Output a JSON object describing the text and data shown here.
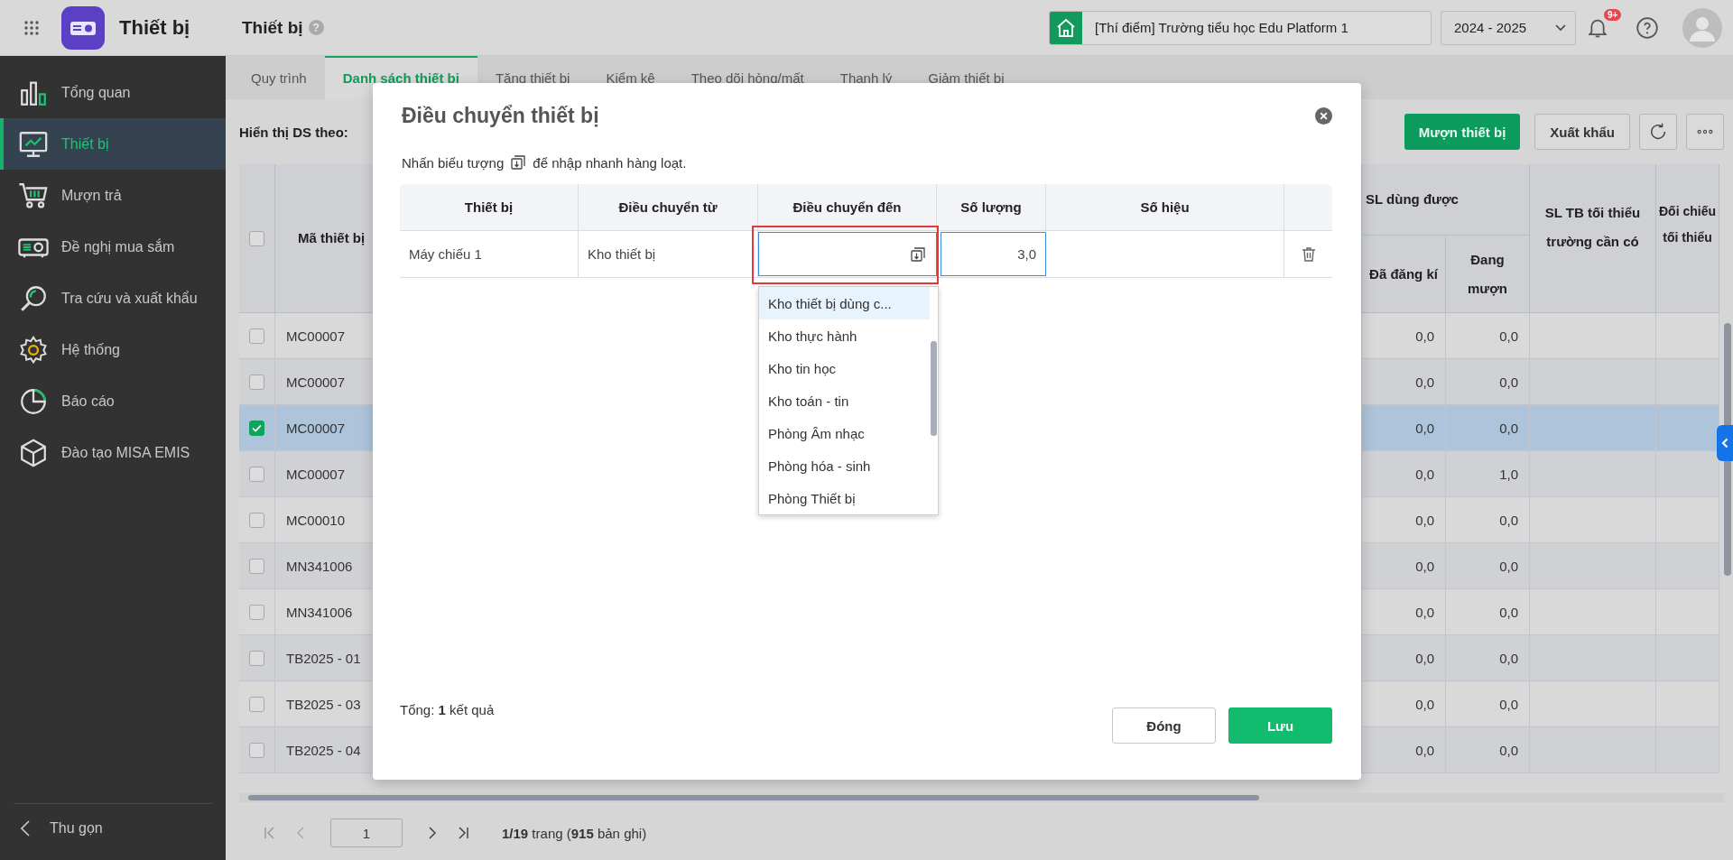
{
  "app": {
    "title": "Thiết bị"
  },
  "header": {
    "page_title": "Thiết bị",
    "help": "?",
    "school": "[Thí điểm] Trường tiểu học Edu Platform 1",
    "school_year": "2024 - 2025",
    "notification_badge": "9+"
  },
  "sidebar": {
    "items": [
      {
        "label": "Tổng quan",
        "selected": false
      },
      {
        "label": "Thiết bị",
        "selected": true
      },
      {
        "label": "Mượn trả",
        "selected": false
      },
      {
        "label": "Đề nghị mua sắm",
        "selected": false
      },
      {
        "label": "Tra cứu và xuất khẩu",
        "selected": false
      },
      {
        "label": "Hệ thống",
        "selected": false
      },
      {
        "label": "Báo cáo",
        "selected": false
      },
      {
        "label": "Đào tạo MISA EMIS",
        "selected": false
      }
    ],
    "collapse": "Thu gọn"
  },
  "tabs": [
    {
      "label": "Quy trình",
      "selected": false
    },
    {
      "label": "Danh sách thiết bị",
      "selected": true
    },
    {
      "label": "Tăng thiết bị",
      "selected": false
    },
    {
      "label": "Kiểm kê",
      "selected": false
    },
    {
      "label": "Theo dõi hỏng/mất",
      "selected": false
    },
    {
      "label": "Thanh lý",
      "selected": false
    },
    {
      "label": "Giảm thiết bị",
      "selected": false
    }
  ],
  "toolbar": {
    "filter_label": "Hiển thị DS theo:",
    "buttons": [
      {
        "label": "Mượn thiết bị",
        "kind": "primary"
      },
      {
        "label": "Xuất khẩu",
        "kind": "secondary"
      }
    ]
  },
  "table": {
    "select_all_checked": false,
    "code_column": "Mã thiết bị",
    "group_column": "SL dùng được",
    "columns": [
      "Đã đăng kí",
      "Đang mượn",
      "SL TB tối thiểu trường cần có",
      "Đối chiếu tối thiểu"
    ],
    "rows": [
      {
        "checked": false,
        "code": "MC00007",
        "registered": "0,0",
        "borrowed": "0,0"
      },
      {
        "checked": false,
        "code": "MC00007",
        "registered": "0,0",
        "borrowed": "0,0"
      },
      {
        "checked": true,
        "code": "MC00007",
        "registered": "0,0",
        "borrowed": "0,0"
      },
      {
        "checked": false,
        "code": "MC00007",
        "registered": "0,0",
        "borrowed": "1,0"
      },
      {
        "checked": false,
        "code": "MC00010",
        "registered": "0,0",
        "borrowed": "0,0"
      },
      {
        "checked": false,
        "code": "MN341006",
        "registered": "0,0",
        "borrowed": "0,0"
      },
      {
        "checked": false,
        "code": "MN341006",
        "registered": "0,0",
        "borrowed": "0,0"
      },
      {
        "checked": false,
        "code": "TB2025 - 01",
        "registered": "0,0",
        "borrowed": "0,0"
      },
      {
        "checked": false,
        "code": "TB2025 - 03",
        "registered": "0,0",
        "borrowed": "0,0"
      },
      {
        "checked": false,
        "code": "TB2025 - 04",
        "registered": "0,0",
        "borrowed": "0,0"
      }
    ]
  },
  "pagination": {
    "page": "1",
    "summary": "**1/19** trang (**915** bản ghi)"
  },
  "dialog": {
    "title": "Điều chuyển thiết bị",
    "hint_before": "Nhấn biểu tượng",
    "hint_after": "để nhập nhanh hàng loạt.",
    "columns": [
      "Thiết bị",
      "Điều chuyển từ",
      "Điều chuyển đến",
      "Số lượng",
      "Số hiệu"
    ],
    "rows": [
      {
        "device": "Máy chiếu 1",
        "from": "Kho thiết bị",
        "quantity": "3,0",
        "highlighted": true
      }
    ],
    "options": [
      {
        "label": "Kho thiết bị dùng c...",
        "selected": true
      },
      {
        "label": "Kho thực hành",
        "selected": false
      },
      {
        "label": "Kho tin học",
        "selected": false
      },
      {
        "label": "Kho toán - tin",
        "selected": false
      },
      {
        "label": "Phòng Âm nhạc",
        "selected": false
      },
      {
        "label": "Phòng hóa - sinh",
        "selected": false
      },
      {
        "label": "Phòng Thiết bị",
        "selected": false
      }
    ],
    "total": "Tổng: **1** kết quả",
    "buttons": [
      {
        "label": "Đóng",
        "kind": "secondary"
      },
      {
        "label": "Lưu",
        "kind": "primary"
      }
    ]
  }
}
